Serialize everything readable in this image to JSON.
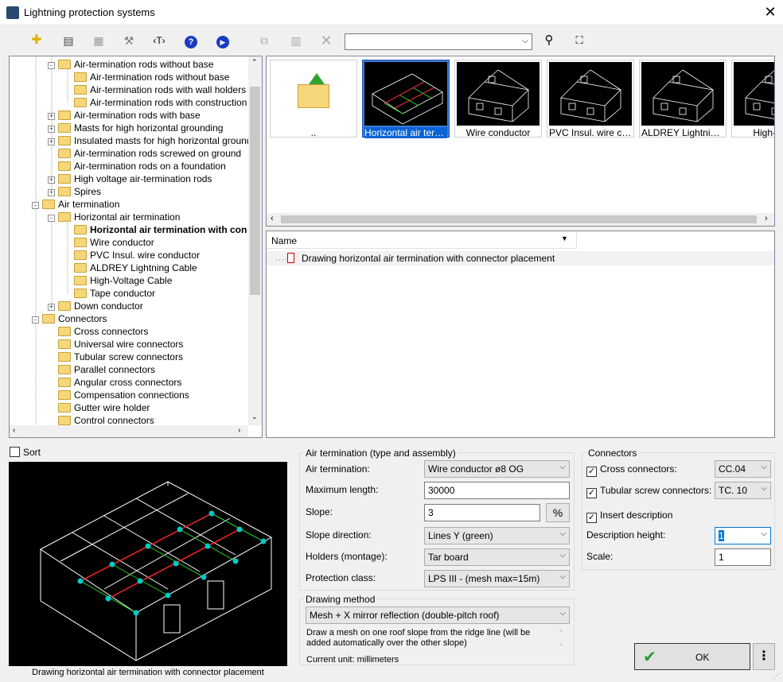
{
  "window": {
    "title": "Lightning protection systems"
  },
  "toolbar": {
    "search_value": ""
  },
  "tree": {
    "items": [
      {
        "label": "Air-termination rods without base",
        "level": 2,
        "exp": "-",
        "bold": false
      },
      {
        "label": "Air-termination rods without base",
        "level": 3,
        "exp": "",
        "bold": false
      },
      {
        "label": "Air-termination rods with wall holders",
        "level": 3,
        "exp": "",
        "bold": false
      },
      {
        "label": "Air-termination rods with construction hol",
        "level": 3,
        "exp": "",
        "bold": false
      },
      {
        "label": "Air-termination rods with base",
        "level": 2,
        "exp": "+",
        "bold": false
      },
      {
        "label": "Masts for high horizontal grounding",
        "level": 2,
        "exp": "+",
        "bold": false
      },
      {
        "label": "Insulated masts for high horizontal grounding",
        "level": 2,
        "exp": "+",
        "bold": false
      },
      {
        "label": "Air-termination rods screwed on ground",
        "level": 2,
        "exp": "",
        "bold": false
      },
      {
        "label": "Air-termination rods on a foundation",
        "level": 2,
        "exp": "",
        "bold": false
      },
      {
        "label": "High voltage air-termination rods",
        "level": 2,
        "exp": "+",
        "bold": false
      },
      {
        "label": "Spires",
        "level": 2,
        "exp": "+",
        "bold": false
      },
      {
        "label": "Air termination",
        "level": 1,
        "exp": "-",
        "bold": false
      },
      {
        "label": "Horizontal air termination",
        "level": 2,
        "exp": "-",
        "bold": false
      },
      {
        "label": "Horizontal air termination with con",
        "level": 3,
        "exp": "",
        "bold": true
      },
      {
        "label": "Wire conductor",
        "level": 3,
        "exp": "",
        "bold": false
      },
      {
        "label": "PVC Insul. wire conductor",
        "level": 3,
        "exp": "",
        "bold": false
      },
      {
        "label": "ALDREY Lightning Cable",
        "level": 3,
        "exp": "",
        "bold": false
      },
      {
        "label": "High-Voltage Cable",
        "level": 3,
        "exp": "",
        "bold": false
      },
      {
        "label": "Tape conductor",
        "level": 3,
        "exp": "",
        "bold": false
      },
      {
        "label": "Down conductor",
        "level": 2,
        "exp": "+",
        "bold": false
      },
      {
        "label": "Connectors",
        "level": 1,
        "exp": "-",
        "bold": false
      },
      {
        "label": "Cross connectors",
        "level": 2,
        "exp": "",
        "bold": false
      },
      {
        "label": "Universal wire connectors",
        "level": 2,
        "exp": "",
        "bold": false
      },
      {
        "label": "Tubular screw connectors",
        "level": 2,
        "exp": "",
        "bold": false
      },
      {
        "label": "Parallel connectors",
        "level": 2,
        "exp": "",
        "bold": false
      },
      {
        "label": "Angular cross connectors",
        "level": 2,
        "exp": "",
        "bold": false
      },
      {
        "label": "Compensation connections",
        "level": 2,
        "exp": "",
        "bold": false
      },
      {
        "label": "Gutter wire holder",
        "level": 2,
        "exp": "",
        "bold": false
      },
      {
        "label": "Control connectors",
        "level": 2,
        "exp": "",
        "bold": false
      }
    ]
  },
  "thumbnails": [
    {
      "label": "..",
      "kind": "up"
    },
    {
      "label": "Horizontal air termi...",
      "kind": "sel"
    },
    {
      "label": "Wire conductor",
      "kind": "house"
    },
    {
      "label": "PVC Insul. wire con...",
      "kind": "house"
    },
    {
      "label": "ALDREY Lightning ...",
      "kind": "house"
    },
    {
      "label": "High-Volta",
      "kind": "house"
    }
  ],
  "list": {
    "header": "Name",
    "rows": [
      "Drawing horizontal air termination with connector placement"
    ]
  },
  "sort_label": "Sort",
  "preview_caption": "Drawing horizontal air termination with connector placement",
  "airterm": {
    "group_title": "Air termination (type and assembly)",
    "air_termination_label": "Air termination:",
    "air_termination_value": "Wire conductor ø8 OG",
    "max_length_label": "Maximum length:",
    "max_length_value": "30000",
    "slope_label": "Slope:",
    "slope_value": "3",
    "slope_btn": "%",
    "slope_dir_label": "Slope direction:",
    "slope_dir_value": "Lines Y (green)",
    "holders_label": "Holders (montage):",
    "holders_value": "Tar board",
    "protection_label": "Protection class:",
    "protection_value": "LPS III - (mesh max=15m)"
  },
  "drawing": {
    "group_title": "Drawing method",
    "method_value": "Mesh + X mirror reflection (double-pitch roof)",
    "description": "Draw a mesh on one roof slope from the ridge line (will be added automatically over the other slope)",
    "current_unit": "Current unit: millimeters"
  },
  "connectors": {
    "group_title": "Connectors",
    "cross_label": "Cross connectors:",
    "cross_value": "CC.04",
    "tubular_label": "Tubular screw connectors:",
    "tubular_value": "TC. 10",
    "insert_desc_label": "Insert description",
    "desc_height_label": "Description height:",
    "desc_height_value": "1",
    "scale_label": "Scale:",
    "scale_value": "1"
  },
  "ok_label": "OK",
  "colors": {
    "selection": "#0a64d6",
    "accent_red": "#ff0000",
    "accent_green": "#00c000",
    "accent_cyan": "#00c8c8"
  }
}
